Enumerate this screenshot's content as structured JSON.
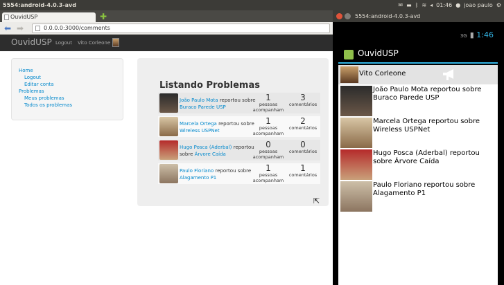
{
  "os_bar": {
    "title": "5554:android-4.0.3-avd",
    "clock": "01:46",
    "user": "joao paulo"
  },
  "browser": {
    "tab_title": "OuvidUSP",
    "url": "0.0.0.0:3000/comments"
  },
  "app": {
    "brand": "OuvidUSP",
    "nav": {
      "logout": "Logout",
      "user": "Vito Corleone"
    }
  },
  "sidebar": {
    "home": "Home",
    "logout": "Logout",
    "edit": "Editar conta",
    "problems": "Problemas",
    "mine": "Meus problemas",
    "all": "Todos os problemas"
  },
  "main": {
    "title": "Listando Problemas",
    "connector": "reportou sobre",
    "followers_label": "pessoas acompanham",
    "comments_label": "comentários",
    "rows": [
      {
        "author": "João Paulo Mota",
        "topic": "Buraco Parede USP",
        "followers": "1",
        "comments": "3"
      },
      {
        "author": "Marcela Ortega",
        "topic": "Wireless USPNet",
        "followers": "1",
        "comments": "2"
      },
      {
        "author": "Hugo Posca (Aderbal)",
        "topic": "Árvore Caída",
        "followers": "0",
        "comments": "0"
      },
      {
        "author": "Paulo Floriano",
        "topic": "Alagamento P1",
        "followers": "1",
        "comments": "1"
      }
    ]
  },
  "emulator": {
    "title": "5554:android-4.0.3-avd",
    "signal": "3G",
    "time": "1:46",
    "app_title": "OuvidUSP",
    "user": "Vito Corleone",
    "items": [
      "João Paulo Mota reportou sobre Buraco Parede USP",
      "Marcela Ortega reportou sobre Wireless USPNet",
      "Hugo Posca (Aderbal) reportou sobre Árvore Caída",
      "Paulo Floriano reportou sobre Alagamento P1"
    ]
  },
  "colors": {
    "link": "#0088cc",
    "accent": "#33b5e5",
    "appbar": "#2d2d2d"
  }
}
